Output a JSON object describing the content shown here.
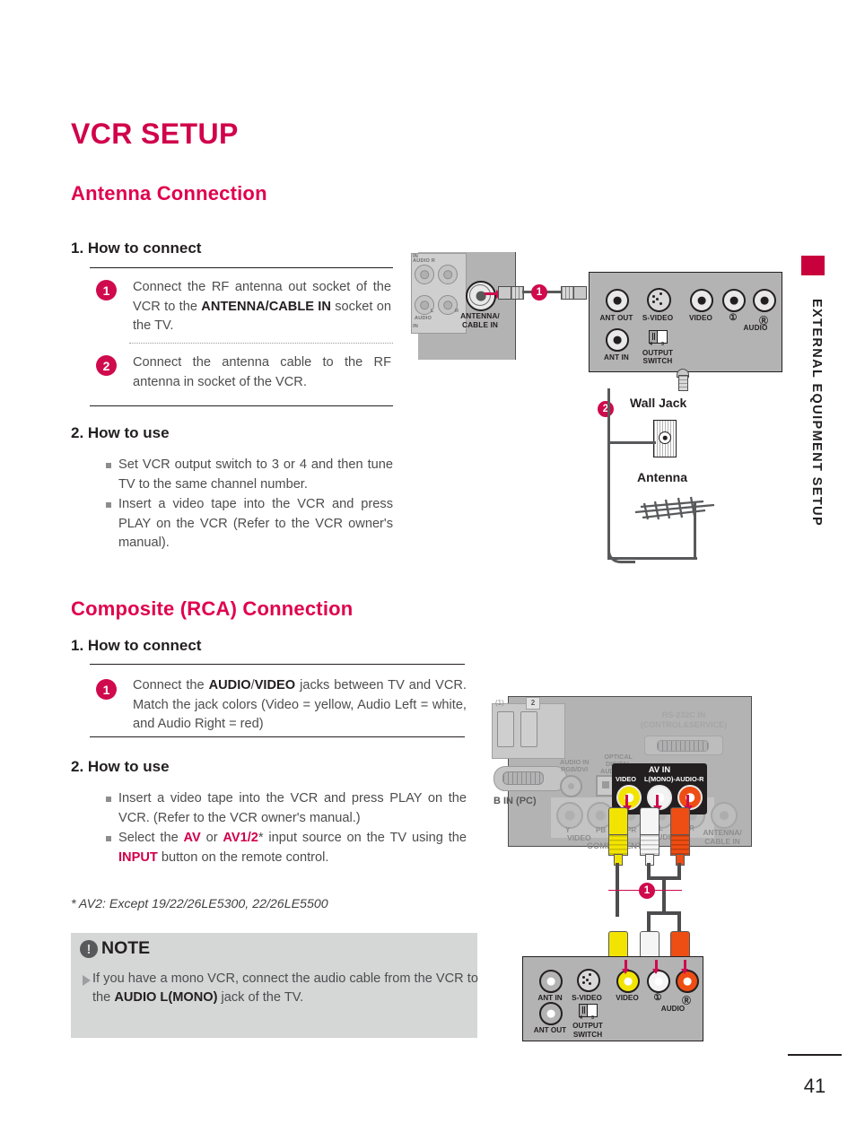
{
  "page": {
    "number": "41",
    "side_tab_label": "EXTERNAL EQUIPMENT SETUP"
  },
  "title": "VCR SETUP",
  "sections": [
    {
      "heading": "Antenna Connection",
      "how_to_connect_heading": "1. How to connect",
      "steps": [
        {
          "num": "1",
          "text_html": "Connect the RF antenna out socket of the VCR to the <b>ANTENNA/CABLE IN</b> socket on the TV."
        },
        {
          "num": "2",
          "text_html": "Connect the antenna cable to the RF antenna in socket of the VCR."
        }
      ],
      "how_to_use_heading": "2. How to use",
      "bullets_html": [
        "Set VCR output switch to 3 or 4 and then tune TV to the same channel number.",
        "Insert a video tape into the VCR and press PLAY on the VCR (Refer to the VCR owner's manual)."
      ]
    },
    {
      "heading": "Composite (RCA) Connection",
      "how_to_connect_heading": "1. How to connect",
      "steps": [
        {
          "num": "1",
          "text_html": "Connect the <b>AUDIO</b>/<b>VIDEO</b> jacks between TV and VCR. Match the jack colors (Video = yellow, Audio Left = white, and Audio Right = red)"
        }
      ],
      "how_to_use_heading": "2. How to use",
      "bullets_html": [
        "Insert a video tape into the VCR and press PLAY on the VCR. (Refer to the VCR owner's manual.)",
        "Select the <span class=\"mag\">AV</span> or <span class=\"mag\">AV1/2</span>* input source on the TV using the <span class=\"mag\">INPUT</span> button on the remote control."
      ]
    }
  ],
  "footnote": "* AV2: Except 19/22/26LE5300, 22/26LE5500",
  "note": {
    "icon": "exclamation-icon",
    "icon_glyph": "!",
    "title": "NOTE",
    "text_html": "If you have a mono VCR, connect the audio cable from the VCR to the <b>AUDIO L(MONO)</b> jack of the TV."
  },
  "diagram_antenna": {
    "tv_panel": {
      "labels": [
        "IN",
        "AUDIO R",
        "L",
        "R",
        "AUDIO",
        "IN"
      ],
      "antenna_jack_label_line1": "ANTENNA/",
      "antenna_jack_label_line2": "CABLE IN"
    },
    "cable_badge": "1",
    "vcr_panel": {
      "jacks": [
        {
          "name": "ant-out-jack",
          "label": "ANT OUT"
        },
        {
          "name": "s-video-jack",
          "label": "S-VIDEO"
        },
        {
          "name": "video-jack",
          "label": "VIDEO"
        },
        {
          "name": "audio-left-jack",
          "label": "L"
        },
        {
          "name": "audio-right-jack",
          "label": "R"
        }
      ],
      "audio_group_label": "AUDIO",
      "ant_in_label": "ANT IN",
      "output_switch_label_line1": "OUTPUT",
      "output_switch_label_line2": "SWITCH",
      "switch_positions": [
        "4",
        "3"
      ]
    },
    "antenna_badge": "2",
    "wall_jack_label": "Wall Jack",
    "antenna_label": "Antenna"
  },
  "diagram_composite": {
    "tv_panel": {
      "hdmi_label": "2",
      "hdmi_label_alt": "(1)",
      "rgb_in_label": "B IN (PC)",
      "audio_in_label_line1": "AUDIO IN",
      "audio_in_label_line2": "RGB/DVI",
      "optical_label_line1": "OPTICAL",
      "optical_label_line2": "DIGITAL",
      "optical_label_line3": "AUDIO OUT",
      "rs232_label_line1": "RS-232C IN",
      "rs232_label_line2": "(CONTROL&SERVICE)",
      "component_labels": {
        "y": "Y",
        "pb": "PB",
        "pr": "PR",
        "l": "L",
        "r": "R",
        "video": "VIDEO",
        "audio": "AUDIO",
        "group": "COMPONENT IN"
      },
      "antenna_label_line1": "ANTENNA/",
      "antenna_label_line2": "CABLE IN"
    },
    "av_in": {
      "title": "AV IN",
      "video_label": "VIDEO",
      "audio_label": "L(MONO)-AUDIO-R",
      "jack_colors": {
        "video": "#f2e400",
        "audio_left": "#f2f2f2",
        "audio_right": "#ee4d13"
      }
    },
    "cable_badge": "1",
    "vcr_panel": {
      "ant_in_label": "ANT IN",
      "ant_out_label": "ANT OUT",
      "s_video_label": "S-VIDEO",
      "video_label": "VIDEO",
      "audio_left_label": "L",
      "audio_right_label": "R",
      "audio_group_label": "AUDIO",
      "output_switch_label_line1": "OUTPUT",
      "output_switch_label_line2": "SWITCH",
      "switch_positions": [
        "4",
        "3"
      ]
    }
  },
  "colors": {
    "brand_magenta": "#d1004b",
    "badge_magenta": "#cf0a4d",
    "body_gray": "#4d4d4f",
    "note_bg": "#d5d6d6"
  }
}
